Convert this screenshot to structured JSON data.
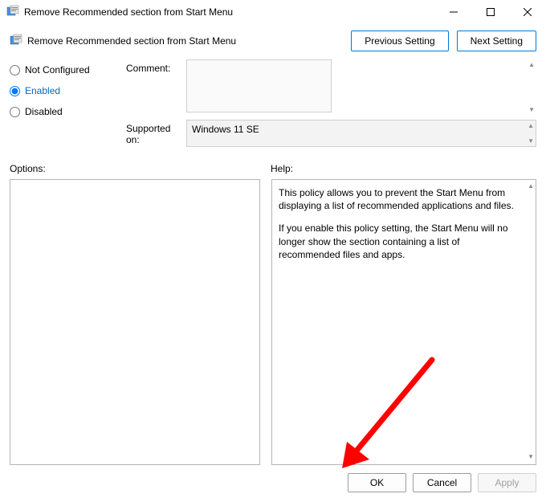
{
  "window": {
    "title": "Remove Recommended section from Start Menu"
  },
  "header": {
    "title": "Remove Recommended section from Start Menu",
    "prev_label": "Previous Setting",
    "next_label": "Next Setting"
  },
  "state": {
    "selected": "enabled",
    "not_configured_label": "Not Configured",
    "enabled_label": "Enabled",
    "disabled_label": "Disabled"
  },
  "fields": {
    "comment_label": "Comment:",
    "comment_value": "",
    "supported_label": "Supported on:",
    "supported_value": "Windows 11 SE"
  },
  "labels": {
    "options": "Options:",
    "help": "Help:"
  },
  "help": {
    "p1": "This policy allows you to prevent the Start Menu from displaying a list of recommended applications and files.",
    "p2": "If you enable this policy setting, the Start Menu will no longer show the section containing a list of recommended files and apps."
  },
  "footer": {
    "ok": "OK",
    "cancel": "Cancel",
    "apply": "Apply"
  },
  "icons": {
    "app": "app-policy-icon",
    "minimize": "minimize-icon",
    "maximize": "maximize-icon",
    "close": "close-icon",
    "scroll_up": "▲",
    "scroll_down": "▼"
  }
}
